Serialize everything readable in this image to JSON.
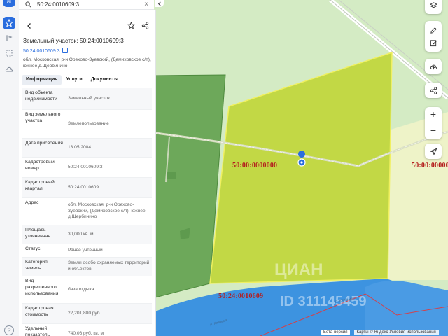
{
  "rail": {
    "logo_letter": "a",
    "help_label": "?"
  },
  "search": {
    "value": "50:24:0010609:3",
    "clear_label": "×"
  },
  "panel": {
    "title": "Земельный участок: 50:24:0010609:3",
    "cadastral_link": "50:24:0010609:3",
    "address": "обл. Московская, р-н Орехово-Зуевский, (Демиховское с/п), южнее д.Щербинино",
    "tabs": [
      {
        "label": "Информация",
        "active": true
      },
      {
        "label": "Услуги",
        "active": false
      },
      {
        "label": "Документы",
        "active": false
      }
    ],
    "rows": [
      {
        "key": "Вид объекта недвижимости",
        "value": "Земельный участок"
      },
      {
        "key": "Вид земельного участка",
        "value": "Землепользование"
      },
      {
        "key": "Дата присвоения",
        "value": "13.05.2004"
      },
      {
        "key": "Кадастровый номер",
        "value": "50:24:0010609:3"
      },
      {
        "key": "Кадастровый квартал",
        "value": "50:24:0010609"
      },
      {
        "key": "Адрес",
        "value": "обл. Московская, р-н Орехово-Зуевский, (Демиховское с/п), южнее д.Щербинино"
      },
      {
        "key": "Площадь уточненная",
        "value": "30,000 кв. м"
      },
      {
        "key": "Статус",
        "value": "Ранее учтенный"
      },
      {
        "key": "Категория земель",
        "value": "Земли особо охраняемых территорий и объектов"
      },
      {
        "key": "Вид разрешенного использования",
        "value": "база отдыха"
      },
      {
        "key": "Кадастровая стоимость",
        "value": "22,201,800 руб."
      },
      {
        "key": "Удельный показатель",
        "value": "740,06 руб. кв. м"
      }
    ]
  },
  "map": {
    "labels": {
      "zone_center": "50:00:0000000",
      "zone_right": "50:00:0000000",
      "quarter": "50:24:0010609"
    },
    "watermark": "ЦИАН",
    "watermark_id": "ID 311145459",
    "zoom_in": "+",
    "zoom_out": "−",
    "river_labels": [
      "р. Клязьма",
      "р. Клязьма"
    ],
    "footer": {
      "beta": "Бета-версия",
      "attribution": "Карты © Яндекс  Условия использования"
    },
    "colors": {
      "parcel_fill": "#c2d845",
      "parcel_stroke": "#f0f060",
      "forest_fill": "#6da85a",
      "water": "#3d93e0",
      "marker": "#2a6dde",
      "boundary": "#d3404a"
    }
  }
}
